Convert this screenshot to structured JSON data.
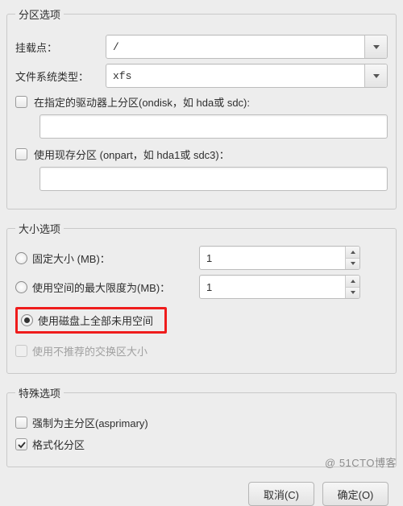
{
  "partition": {
    "legend": "分区选项",
    "mount_label": "挂载点：",
    "mount_value": "/",
    "fs_label": "文件系统类型：",
    "fs_value": "xfs",
    "ondisk_label": "在指定的驱动器上分区(ondisk，如 hda或 sdc):",
    "ondisk_checked": false,
    "ondisk_value": "",
    "onpart_label": "使用现存分区 (onpart，如 hda1或 sdc3)：",
    "onpart_checked": false,
    "onpart_value": ""
  },
  "size": {
    "legend": "大小选项",
    "fixed_label": "固定大小 (MB)：",
    "fixed_value": "1",
    "grow_label": "使用空间的最大限度为(MB)：",
    "grow_value": "1",
    "fill_label": "使用磁盘上全部未用空间",
    "recswap_label": "使用不推荐的交换区大小",
    "selected": "fill"
  },
  "special": {
    "legend": "特殊选项",
    "asprimary_label": "强制为主分区(asprimary)",
    "asprimary_checked": false,
    "format_label": "格式化分区",
    "format_checked": true
  },
  "buttons": {
    "cancel": "取消(C)",
    "ok": "确定(O)"
  },
  "watermark": "@ 51CTO博客"
}
